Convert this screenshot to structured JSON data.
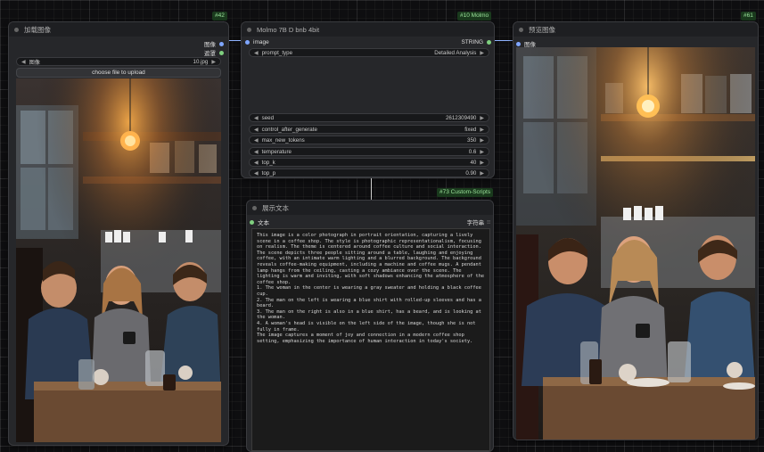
{
  "nodes": {
    "load_image": {
      "title": "加载图像",
      "badge": "#42",
      "outputs": [
        "图像",
        "遮罩"
      ],
      "image_label": "图像",
      "image_value": "10.jpg",
      "upload_button": "choose file to upload"
    },
    "molmo": {
      "title": "Molmo 7B D bnb 4bit",
      "badge": "#10 Molmo",
      "input": "image",
      "output": "STRING",
      "widgets": [
        {
          "name": "prompt_type",
          "value": "Detailed Analysis"
        },
        {
          "name": "seed",
          "value": "2612309490"
        },
        {
          "name": "control_after_generate",
          "value": "fixed"
        },
        {
          "name": "max_new_tokens",
          "value": "350"
        },
        {
          "name": "temperature",
          "value": "0.6"
        },
        {
          "name": "top_k",
          "value": "40"
        },
        {
          "name": "top_p",
          "value": "0.90"
        }
      ]
    },
    "show_text": {
      "title": "展示文本",
      "badge": "#73 Custom-Scripts",
      "input": "文本",
      "output": "字符串",
      "text": "This image is a color photograph in portrait orientation, capturing a lively scene in a coffee shop. The style is photographic representationalism, focusing on realism. The theme is centered around coffee culture and social interaction. The scene depicts three people sitting around a table, laughing and enjoying coffee, with an intimate warm lighting and a blurred background. The background reveals coffee-making equipment, including a machine and coffee mugs. A pendant lamp hangs from the ceiling, casting a cozy ambiance over the scene. The lighting is warm and inviting, with soft shadows enhancing the atmosphere of the coffee shop.\n1. The woman in the center is wearing a gray sweater and holding a black coffee cup.\n2. The man on the left is wearing a blue shirt with rolled-up sleeves and has a beard.\n3. The man on the right is also in a blue shirt, has a beard, and is looking at the woman.\n4. A woman's head is visible on the left side of the image, though she is not fully in frame.\nThe image captures a moment of joy and connection in a modern coffee shop setting, emphasizing the importance of human interaction in today's society."
    },
    "preview": {
      "title": "预览图像",
      "badge": "#61",
      "input": "图像"
    }
  }
}
